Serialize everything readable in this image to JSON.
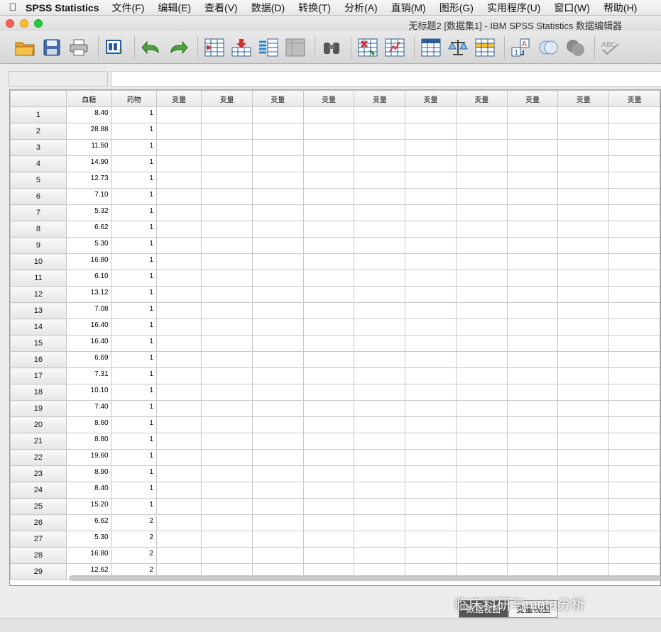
{
  "menubar": {
    "app_name": "SPSS Statistics",
    "items": [
      "文件(F)",
      "编辑(E)",
      "查看(V)",
      "数据(D)",
      "转换(T)",
      "分析(A)",
      "直销(M)",
      "图形(G)",
      "实用程序(U)",
      "窗口(W)",
      "帮助(H)"
    ]
  },
  "window": {
    "title": "无标题2 [数据集1] - IBM SPSS Statistics 数据编辑器"
  },
  "toolbar": {
    "icons": [
      "open-folder-icon",
      "save-icon",
      "print-icon",
      "dialog-recall-icon",
      "undo-icon",
      "redo-icon",
      "goto-case-icon",
      "goto-variable-icon",
      "variables-icon",
      "run-descriptives-icon",
      "find-icon",
      "insert-cases-icon",
      "insert-variable-icon",
      "split-file-icon",
      "weight-cases-icon",
      "select-cases-icon",
      "value-labels-icon",
      "use-sets-icon",
      "show-all-variables-icon",
      "spelling-icon"
    ]
  },
  "grid": {
    "columns": [
      "血糖",
      "药物"
    ],
    "placeholder_column": "变量",
    "placeholder_count": 10,
    "rows": [
      {
        "n": "1",
        "glucose": "8.40",
        "drug": "1"
      },
      {
        "n": "2",
        "glucose": "28.88",
        "drug": "1"
      },
      {
        "n": "3",
        "glucose": "11.50",
        "drug": "1"
      },
      {
        "n": "4",
        "glucose": "14.90",
        "drug": "1"
      },
      {
        "n": "5",
        "glucose": "12.73",
        "drug": "1"
      },
      {
        "n": "6",
        "glucose": "7.10",
        "drug": "1"
      },
      {
        "n": "7",
        "glucose": "5.32",
        "drug": "1"
      },
      {
        "n": "8",
        "glucose": "6.62",
        "drug": "1"
      },
      {
        "n": "9",
        "glucose": "5.30",
        "drug": "1"
      },
      {
        "n": "10",
        "glucose": "16.80",
        "drug": "1"
      },
      {
        "n": "11",
        "glucose": "6.10",
        "drug": "1"
      },
      {
        "n": "12",
        "glucose": "13.12",
        "drug": "1"
      },
      {
        "n": "13",
        "glucose": "7.08",
        "drug": "1"
      },
      {
        "n": "14",
        "glucose": "16.40",
        "drug": "1"
      },
      {
        "n": "15",
        "glucose": "16.40",
        "drug": "1"
      },
      {
        "n": "16",
        "glucose": "6.69",
        "drug": "1"
      },
      {
        "n": "17",
        "glucose": "7.31",
        "drug": "1"
      },
      {
        "n": "18",
        "glucose": "10.10",
        "drug": "1"
      },
      {
        "n": "19",
        "glucose": "7.40",
        "drug": "1"
      },
      {
        "n": "20",
        "glucose": "8.60",
        "drug": "1"
      },
      {
        "n": "21",
        "glucose": "8.80",
        "drug": "1"
      },
      {
        "n": "22",
        "glucose": "19.60",
        "drug": "1"
      },
      {
        "n": "23",
        "glucose": "8.90",
        "drug": "1"
      },
      {
        "n": "24",
        "glucose": "8.40",
        "drug": "1"
      },
      {
        "n": "25",
        "glucose": "15.20",
        "drug": "1"
      },
      {
        "n": "26",
        "glucose": "6.62",
        "drug": "2"
      },
      {
        "n": "27",
        "glucose": "5.30",
        "drug": "2"
      },
      {
        "n": "28",
        "glucose": "16.80",
        "drug": "2"
      },
      {
        "n": "29",
        "glucose": "12.62",
        "drug": "2"
      }
    ]
  },
  "tabs": [
    "数据视图",
    "变量视图"
  ],
  "watermark": "临床科研与meta分析"
}
